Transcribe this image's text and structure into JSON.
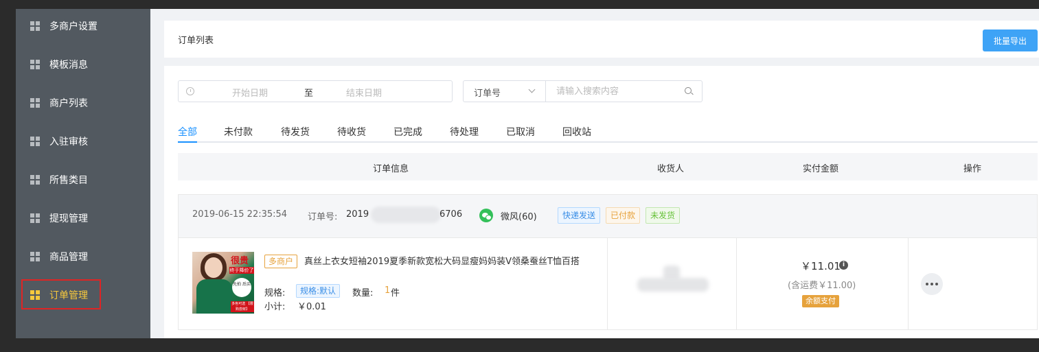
{
  "sidebar": {
    "items": [
      {
        "label": "多商户设置"
      },
      {
        "label": "模板消息"
      },
      {
        "label": "商户列表"
      },
      {
        "label": "入驻审核"
      },
      {
        "label": "所售类目"
      },
      {
        "label": "提现管理"
      },
      {
        "label": "商品管理"
      },
      {
        "label": "订单管理",
        "active": true
      }
    ]
  },
  "header": {
    "title": "订单列表",
    "export_label": "批量导出"
  },
  "filters": {
    "start_placeholder": "开始日期",
    "range_sep": "至",
    "end_placeholder": "结束日期",
    "search_type": "订单号",
    "search_placeholder": "请输入搜索内容"
  },
  "tabs": [
    "全部",
    "未付款",
    "待发货",
    "待收货",
    "已完成",
    "待处理",
    "已取消",
    "回收站"
  ],
  "table": {
    "columns": [
      "订单信息",
      "收货人",
      "实付金额",
      "操作"
    ]
  },
  "order": {
    "time": "2019-06-15 22:35:54",
    "no_label": "订单号:",
    "no_head": "2019",
    "no_tail": "6706",
    "buyer": "微风(60)",
    "tags": [
      "快递发送",
      "已付款",
      "未发货"
    ],
    "product": {
      "merchant_tag": "多商户",
      "title": "真丝上衣女短袖2019夏季新款宽松大码显瘦妈妈装V领桑蚕丝T恤百搭",
      "img_promo": "很贵",
      "img_promo2": "终于降价了",
      "img_promo3": "先拍 后买",
      "img_promo4": "多色可选 【限购尝鲜】",
      "spec_label": "规格:",
      "spec_value": "规格:默认",
      "qty_label": "数量:",
      "qty_value": "1",
      "qty_unit": "件",
      "subtotal_label": "小计:",
      "subtotal_value": "￥0.01"
    },
    "amount": "￥11.01",
    "shipping": "(含运费￥11.00)",
    "pay_method": "余额支付"
  },
  "colors": {
    "sidebar_bg": "#525960",
    "active": "#f7c93d",
    "primary": "#3ea3f6",
    "tab_active": "#1890ff"
  }
}
